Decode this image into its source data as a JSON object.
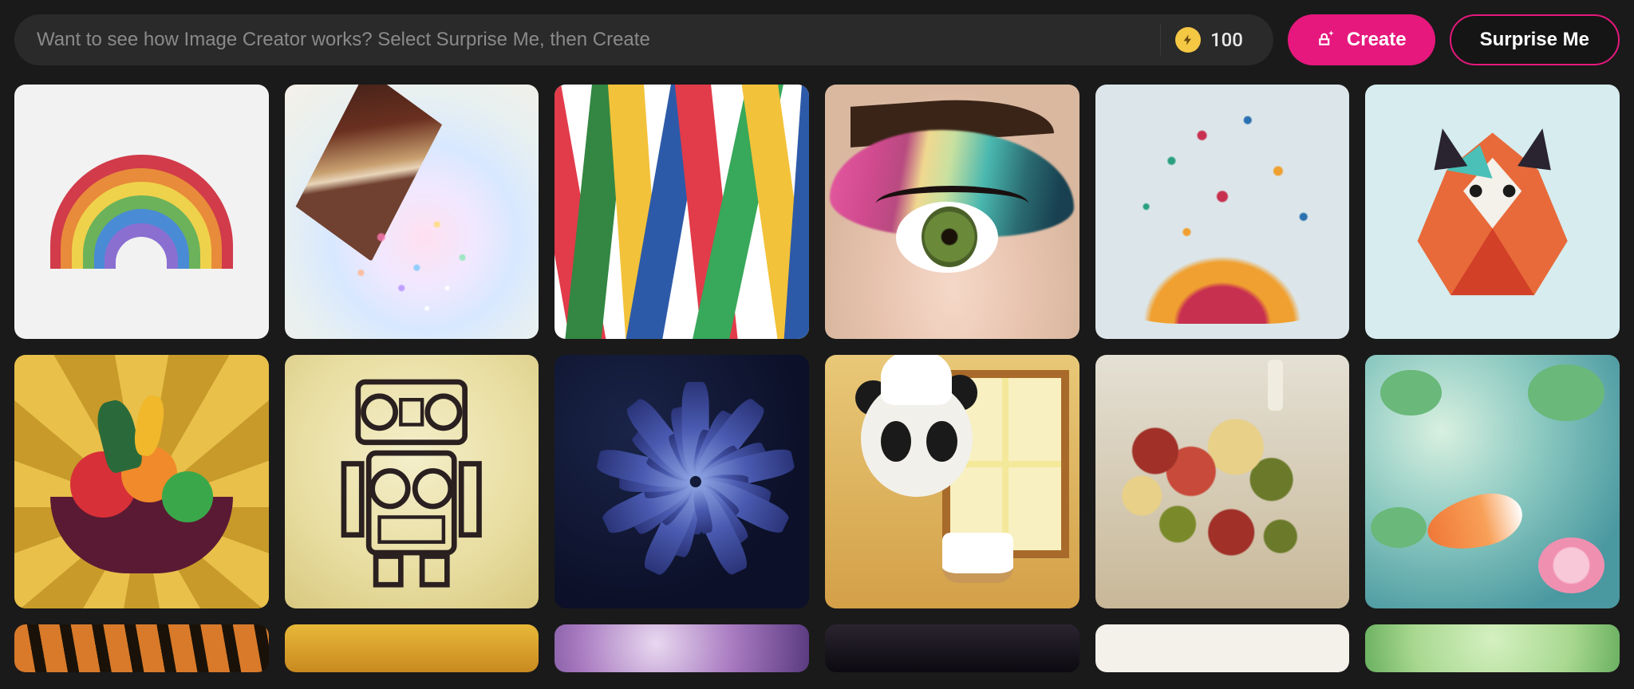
{
  "header": {
    "prompt_placeholder": "Want to see how Image Creator works? Select Surprise Me, then Create",
    "credits_count": "100",
    "create_label": "Create",
    "surprise_label": "Surprise Me"
  },
  "gallery": {
    "tiles": [
      {
        "name": "rainbow-paper-art"
      },
      {
        "name": "pencil-sparkle"
      },
      {
        "name": "colorful-streamers"
      },
      {
        "name": "eye-makeup-closeup"
      },
      {
        "name": "color-splash"
      },
      {
        "name": "paper-fox"
      },
      {
        "name": "fruit-bowl-geometric"
      },
      {
        "name": "retro-robot-boombox"
      },
      {
        "name": "blue-dahlia-flower"
      },
      {
        "name": "panda-chef-cake"
      },
      {
        "name": "charcuterie-board"
      },
      {
        "name": "koi-pond-watercolor"
      },
      {
        "name": "tiger-stripes-peek"
      },
      {
        "name": "gold-peek"
      },
      {
        "name": "purple-swirl-peek"
      },
      {
        "name": "dark-abstract-peek"
      },
      {
        "name": "paper-white-peek"
      },
      {
        "name": "green-nature-peek"
      }
    ]
  },
  "colors": {
    "accent": "#e6187d",
    "bg": "#1a1a1a",
    "input_bg": "#2a2a2a",
    "coin": "#f5c844"
  }
}
